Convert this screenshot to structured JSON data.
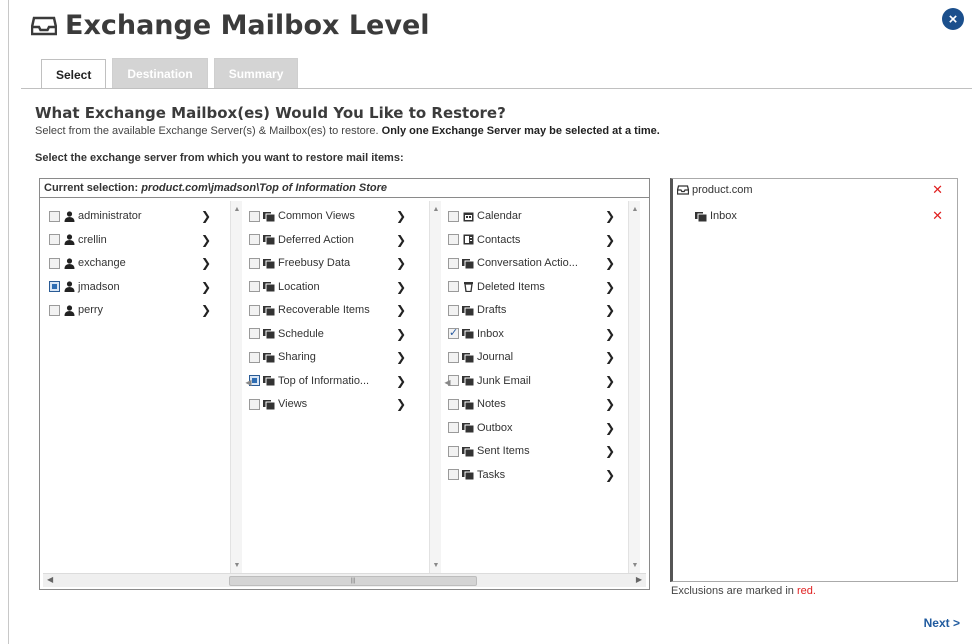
{
  "dialog": {
    "title": "Exchange Mailbox Level",
    "close_label": "×"
  },
  "tabs": [
    {
      "label": "Select",
      "active": true
    },
    {
      "label": "Destination",
      "active": false
    },
    {
      "label": "Summary",
      "active": false
    }
  ],
  "heading": "What Exchange Mailbox(es) Would You Like to Restore?",
  "subtext": {
    "normal": "Select from the available Exchange Server(s) & Mailbox(es) to restore. ",
    "bold": "Only one Exchange Server may be selected at a time."
  },
  "select_label": "Select the exchange server from which you want to restore mail items:",
  "current_selection": {
    "label": "Current selection: ",
    "path": "product.com\\jmadson\\Top of Information Store"
  },
  "columns": {
    "users": [
      {
        "label": "administrator",
        "state": "none"
      },
      {
        "label": "crellin",
        "state": "none"
      },
      {
        "label": "exchange",
        "state": "none"
      },
      {
        "label": "jmadson",
        "state": "partial"
      },
      {
        "label": "perry",
        "state": "none"
      }
    ],
    "folders": [
      {
        "label": "Common Views",
        "state": "none"
      },
      {
        "label": "Deferred Action",
        "state": "none"
      },
      {
        "label": "Freebusy Data",
        "state": "none"
      },
      {
        "label": "Location",
        "state": "none"
      },
      {
        "label": "Recoverable Items",
        "state": "none"
      },
      {
        "label": "Schedule",
        "state": "none"
      },
      {
        "label": "Sharing",
        "state": "none"
      },
      {
        "label": "Top of Informatio...",
        "state": "partial"
      },
      {
        "label": "Views",
        "state": "none"
      }
    ],
    "items": [
      {
        "label": "Calendar",
        "state": "none",
        "icon": "calendar-icon"
      },
      {
        "label": "Contacts",
        "state": "none",
        "icon": "contacts-icon"
      },
      {
        "label": "Conversation Actio...",
        "state": "none",
        "icon": "folder-icon"
      },
      {
        "label": "Deleted Items",
        "state": "none",
        "icon": "trash-icon"
      },
      {
        "label": "Drafts",
        "state": "none",
        "icon": "folder-icon"
      },
      {
        "label": "Inbox",
        "state": "checked",
        "icon": "folder-icon"
      },
      {
        "label": "Journal",
        "state": "none",
        "icon": "folder-icon"
      },
      {
        "label": "Junk Email",
        "state": "none",
        "icon": "folder-icon"
      },
      {
        "label": "Notes",
        "state": "none",
        "icon": "folder-icon"
      },
      {
        "label": "Outbox",
        "state": "none",
        "icon": "folder-icon"
      },
      {
        "label": "Sent Items",
        "state": "none",
        "icon": "folder-icon"
      },
      {
        "label": "Tasks",
        "state": "none",
        "icon": "folder-icon"
      }
    ],
    "expand_arrow": "❯"
  },
  "selection_panel": [
    {
      "label": "product.com",
      "icon": "server-icon",
      "remove": "✕"
    },
    {
      "label": "Inbox",
      "icon": "folder-icon",
      "remove": "✕"
    }
  ],
  "exclusions_note": {
    "text": "Exclusions are marked in ",
    "red": "red."
  },
  "next_label": "Next >",
  "colors": {
    "accent": "#1f5a9e",
    "exclusion": "#e02020",
    "checkbox_filled": "#2e6db3"
  }
}
